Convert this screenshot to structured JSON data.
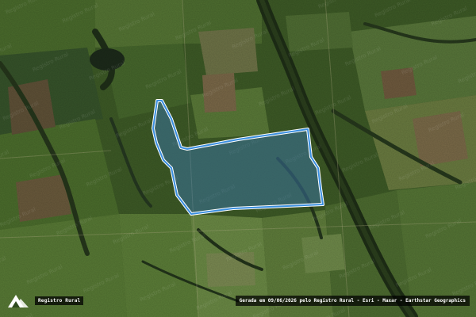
{
  "map": {
    "source": "Registro Rural",
    "property_outline_color": "#3b8fe0",
    "property_fill_color": "#3a79b8"
  },
  "brand": {
    "name": "Registro Rural",
    "logo_icon": "registro-rural-logo-icon"
  },
  "attribution": {
    "text": "Gerada em 09/06/2026 pelo Registro Rural - Esri - Maxar - Earthstar Geographics"
  }
}
